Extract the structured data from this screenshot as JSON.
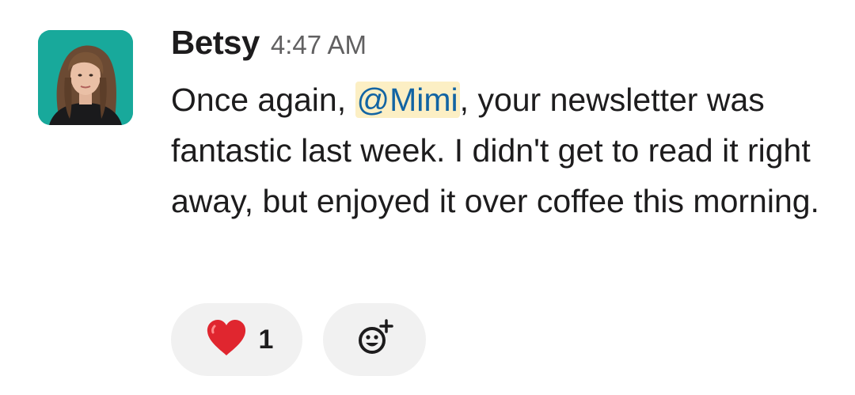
{
  "message": {
    "author": "Betsy",
    "timestamp": "4:47 AM",
    "text_before_mention": "Once again, ",
    "mention": "@Mimi",
    "text_after_mention": ", your newsletter was fantastic last week. I didn't get to read it right away, but enjoyed it over coffee this morning."
  },
  "reactions": [
    {
      "emoji": "red-heart",
      "count": "1"
    }
  ],
  "add_reaction_icon": "add-emoji-icon",
  "colors": {
    "mention_bg": "#fcefc4",
    "mention_text": "#1264a3",
    "avatar_bg": "#18a99b",
    "pill_bg": "#f1f1f1",
    "heart": "#e0262f"
  }
}
